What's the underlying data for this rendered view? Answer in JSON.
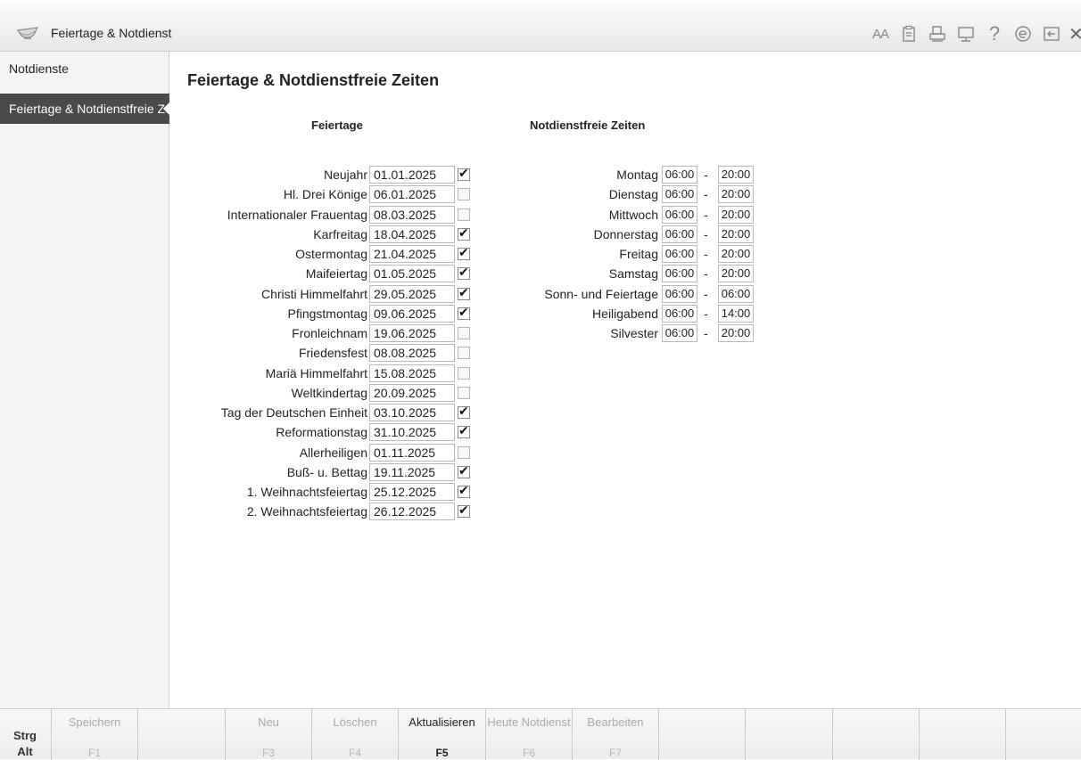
{
  "window": {
    "title": "Feiertage & Notdienst"
  },
  "titlebar_icons": [
    "font-size-icon",
    "clipboard-icon",
    "print-icon",
    "monitor-icon",
    "help-icon",
    "e-icon",
    "exit-icon",
    "close-icon"
  ],
  "titlebar_glyphs": {
    "font_size": "AA",
    "help": "?",
    "close": "✕"
  },
  "sidebar": {
    "items": [
      {
        "label": "Notdienste",
        "active": false
      },
      {
        "label": "Feiertage & Notdienstfreie Zeiten",
        "active": true
      }
    ]
  },
  "main": {
    "title": "Feiertage & Notdienstfreie Zeiten",
    "holidays_heading": "Feiertage",
    "offhours_heading": "Notdienstfreie Zeiten",
    "holidays": [
      {
        "name": "Neujahr",
        "date": "01.01.2025",
        "checked": true
      },
      {
        "name": "Hl. Drei Könige",
        "date": "06.01.2025",
        "checked": false
      },
      {
        "name": "Internationaler Frauentag",
        "date": "08.03.2025",
        "checked": false
      },
      {
        "name": "Karfreitag",
        "date": "18.04.2025",
        "checked": true
      },
      {
        "name": "Ostermontag",
        "date": "21.04.2025",
        "checked": true
      },
      {
        "name": "Maifeiertag",
        "date": "01.05.2025",
        "checked": true
      },
      {
        "name": "Christi Himmelfahrt",
        "date": "29.05.2025",
        "checked": true
      },
      {
        "name": "Pfingstmontag",
        "date": "09.06.2025",
        "checked": true
      },
      {
        "name": "Fronleichnam",
        "date": "19.06.2025",
        "checked": false
      },
      {
        "name": "Friedensfest",
        "date": "08.08.2025",
        "checked": false
      },
      {
        "name": "Mariä Himmelfahrt",
        "date": "15.08.2025",
        "checked": false
      },
      {
        "name": "Weltkindertag",
        "date": "20.09.2025",
        "checked": false
      },
      {
        "name": "Tag der Deutschen Einheit",
        "date": "03.10.2025",
        "checked": true
      },
      {
        "name": "Reformationstag",
        "date": "31.10.2025",
        "checked": true
      },
      {
        "name": "Allerheiligen",
        "date": "01.11.2025",
        "checked": false
      },
      {
        "name": "Buß- u. Bettag",
        "date": "19.11.2025",
        "checked": true
      },
      {
        "name": "1. Weihnachtsfeiertag",
        "date": "25.12.2025",
        "checked": true
      },
      {
        "name": "2. Weihnachtsfeiertag",
        "date": "26.12.2025",
        "checked": true
      }
    ],
    "offhours": [
      {
        "day": "Montag",
        "from": "06:00",
        "to": "20:00"
      },
      {
        "day": "Dienstag",
        "from": "06:00",
        "to": "20:00"
      },
      {
        "day": "Mittwoch",
        "from": "06:00",
        "to": "20:00"
      },
      {
        "day": "Donnerstag",
        "from": "06:00",
        "to": "20:00"
      },
      {
        "day": "Freitag",
        "from": "06:00",
        "to": "20:00"
      },
      {
        "day": "Samstag",
        "from": "06:00",
        "to": "20:00"
      },
      {
        "day": "Sonn- und Feiertage",
        "from": "06:00",
        "to": "06:00"
      },
      {
        "day": "Heiligabend",
        "from": "06:00",
        "to": "14:00"
      },
      {
        "day": "Silvester",
        "from": "06:00",
        "to": "20:00"
      }
    ],
    "range_separator": "-"
  },
  "fbar": {
    "modifiers": [
      "Strg",
      "Alt"
    ],
    "keys": [
      {
        "label": "Speichern",
        "key": "F1",
        "enabled": false
      },
      {
        "label": "",
        "key": "",
        "enabled": false
      },
      {
        "label": "Neu",
        "key": "F3",
        "enabled": false
      },
      {
        "label": "Löschen",
        "key": "F4",
        "enabled": false
      },
      {
        "label": "Aktualisieren",
        "key": "F5",
        "enabled": true
      },
      {
        "label": "Heute Notdienst",
        "key": "F6",
        "enabled": false
      },
      {
        "label": "Bearbeiten",
        "key": "F7",
        "enabled": false
      },
      {
        "label": "",
        "key": "",
        "enabled": false
      },
      {
        "label": "",
        "key": "",
        "enabled": false
      },
      {
        "label": "",
        "key": "",
        "enabled": false
      },
      {
        "label": "",
        "key": "",
        "enabled": false
      },
      {
        "label": "",
        "key": "",
        "enabled": false
      }
    ]
  }
}
